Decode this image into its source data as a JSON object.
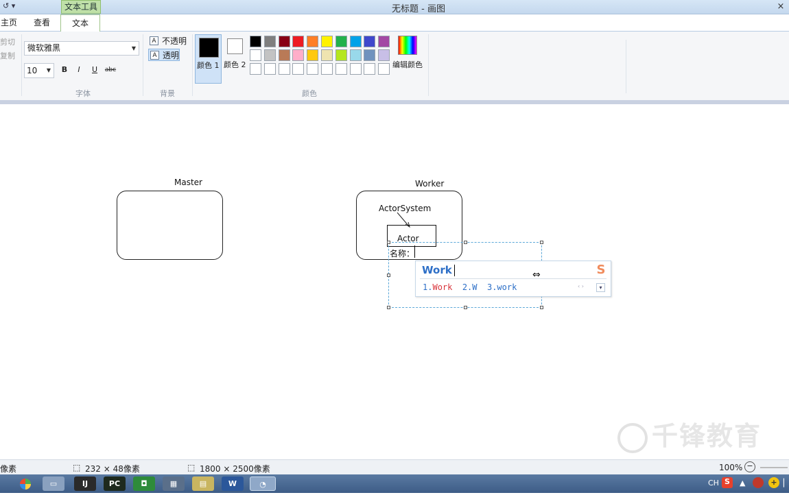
{
  "titlebar": {
    "quick_access": "↺ ▾",
    "context_tab": "文本工具",
    "title": "无标题 - 画图",
    "close": "×"
  },
  "tabs": {
    "home": "主页",
    "view": "查看",
    "text": "文本"
  },
  "ribbon": {
    "clipboard": {
      "cut": "剪切",
      "copy": "复制"
    },
    "font": {
      "family_value": "微软雅黑",
      "size_value": "10",
      "bold": "B",
      "italic": "I",
      "underline": "U",
      "strike": "abc",
      "group_label": "字体"
    },
    "background": {
      "opaque": "不透明",
      "transparent": "透明",
      "group_label": "背景"
    },
    "colors": {
      "color1_label": "颜色 1",
      "color2_label": "颜色 2",
      "edit_label": "编辑颜色",
      "group_label": "颜色",
      "color1": "#000000",
      "color2": "#ffffff",
      "palette_row1": [
        "#000000",
        "#7f7f7f",
        "#880015",
        "#ed1c24",
        "#ff7f27",
        "#fff200",
        "#22b14c",
        "#00a2e8",
        "#3f48cc",
        "#a349a4"
      ],
      "palette_row2": [
        "#ffffff",
        "#c3c3c3",
        "#b97a57",
        "#ffaec9",
        "#ffc90e",
        "#efe4b0",
        "#b5e61d",
        "#99d9ea",
        "#7092be",
        "#c8bfe7"
      ],
      "palette_row3": [
        "#ffffff",
        "#ffffff",
        "#ffffff",
        "#ffffff",
        "#ffffff",
        "#ffffff",
        "#ffffff",
        "#ffffff",
        "#ffffff",
        "#ffffff"
      ]
    }
  },
  "canvas": {
    "master_label": "Master",
    "worker_label": "Worker",
    "actorsystem_label": "ActorSystem",
    "actor_label": "Actor",
    "text_prefix": "名称："
  },
  "ime": {
    "composition": "Work",
    "cand1_num": "1.",
    "cand1_hl": "W",
    "cand1_rest": "ork",
    "cand2": "2.W",
    "cand3": "3.work",
    "logo": "S",
    "nav": "‹ ›",
    "more": "▾"
  },
  "watermark": "千锋教育",
  "status": {
    "pos_partial": "像素",
    "selection_size": "232 × 48像素",
    "canvas_size": "1800 × 2500像素",
    "zoom": "100%"
  },
  "taskbar": {
    "apps": [
      "IJ",
      "PC",
      "W"
    ],
    "tray_lang": "CH",
    "tray_ime": "S"
  }
}
